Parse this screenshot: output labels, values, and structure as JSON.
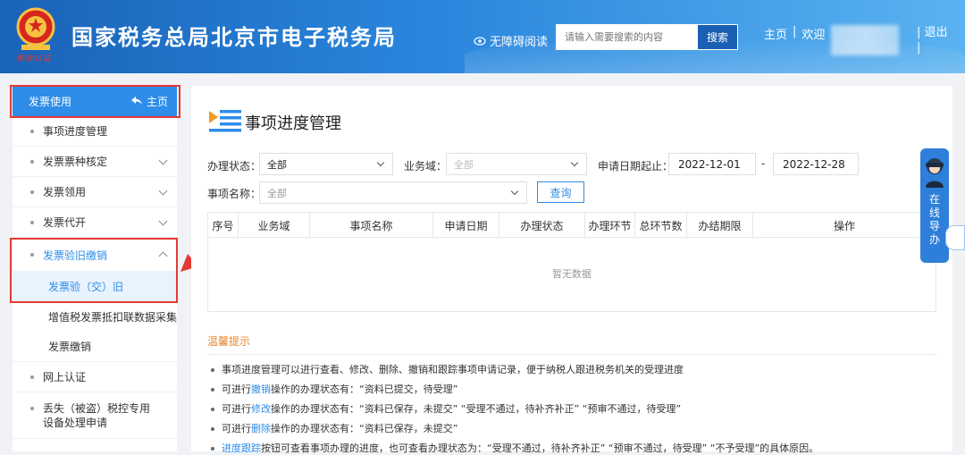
{
  "header": {
    "site_title": "国家税务总局北京市电子税务局",
    "emblem_subtitle": "税收认证",
    "accessibility_label": "无障碍阅读",
    "search_placeholder": "请输入需要搜索的内容",
    "search_button": "搜索",
    "home_link": "主页",
    "separator": "|",
    "welcome": "欢迎",
    "logout": "退出"
  },
  "sidebar": {
    "head_label": "发票使用",
    "home_label": "主页",
    "items": [
      {
        "label": "事项进度管理"
      },
      {
        "label": "发票票种核定"
      },
      {
        "label": "发票领用"
      },
      {
        "label": "发票代开"
      },
      {
        "label": "发票验旧缴销"
      },
      {
        "label": "发票验（交）旧"
      },
      {
        "label": "增值税发票抵扣联数据采集"
      },
      {
        "label": "发票缴销"
      },
      {
        "label": "网上认证"
      },
      {
        "label": "丢失（被盗）税控专用设备处理申请"
      }
    ]
  },
  "main": {
    "page_title": "事项进度管理",
    "filters": {
      "status_label": "办理状态：",
      "status_value": "全部",
      "domain_label": "业务域：",
      "domain_value": "全部",
      "date_label": "申请日期起止：",
      "date_start": "2022-12-01",
      "date_sep": "-",
      "date_end": "2022-12-28",
      "name_label": "事项名称：",
      "name_value": "全部",
      "query_button": "查询"
    },
    "table": {
      "columns": [
        "序号",
        "业务域",
        "事项名称",
        "申请日期",
        "办理状态",
        "办理环节",
        "总环节数",
        "办结期限",
        "操作"
      ],
      "empty_text": "暂无数据"
    },
    "tips": {
      "title": "温馨提示",
      "lines": [
        {
          "pre": "事项进度管理可以进行查看、修改、删除、撤销和跟踪事项申请记录，便于纳税人跟进税务机关的受理进度",
          "hl": "",
          "post": ""
        },
        {
          "pre": "可进行",
          "hl": "撤销",
          "post": "操作的办理状态有：“资料已提交，待受理”"
        },
        {
          "pre": "可进行",
          "hl": "修改",
          "post": "操作的办理状态有：“资料已保存，未提交”  “受理不通过，待补齐补正”  “预审不通过，待受理”"
        },
        {
          "pre": "可进行",
          "hl": "删除",
          "post": "操作的办理状态有：“资料已保存，未提交”"
        },
        {
          "pre": "",
          "hl": "进度跟踪",
          "post": "按钮可查看事项办理的进度，也可查看办理状态为：“受理不通过，待补齐补正”  “预审不通过，待受理”  “不予受理”的具体原因。"
        }
      ]
    }
  },
  "float": {
    "guide_label": "在线导办"
  },
  "colors": {
    "header_start": "#1a63b8",
    "accent": "#2e8de8",
    "highlight_box": "#e53935",
    "tips_title": "#e6862b"
  }
}
